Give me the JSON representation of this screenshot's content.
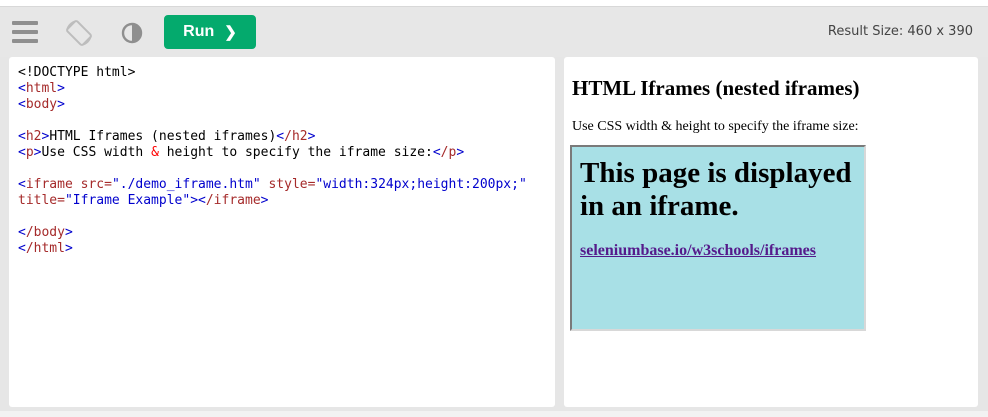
{
  "toolbar": {
    "run_label": "Run",
    "run_chevron": "❯",
    "result_size": "Result Size: 460 x 390",
    "icons": [
      "menu-icon",
      "rotate-icon",
      "contrast-icon"
    ],
    "colors": {
      "run_bg": "#04aa6d",
      "toolbar_bg": "#e7e7e7"
    }
  },
  "code": {
    "line1": "<!DOCTYPE html>",
    "html_open": "html",
    "body_open": "body",
    "h2_open": "h2",
    "h2_text": "HTML Iframes (nested iframes)",
    "h2_close": "/h2",
    "p_open": "p",
    "p_text1": "Use CSS width ",
    "p_entity": "&",
    "p_text2": " height to specify the iframe size:",
    "p_close": "/p",
    "iframe_tag": "iframe",
    "src_attr": " src=",
    "src_val": "\"./demo_iframe.htm\"",
    "style_attr": " style=",
    "style_val": "\"width:324px;height:200px;\"",
    "title_attr": "title=",
    "title_val": "\"Iframe Example\"",
    "iframe_close": "/iframe",
    "body_close": "/body",
    "html_close": "/html"
  },
  "result": {
    "heading": "HTML Iframes (nested iframes)",
    "paragraph": "Use CSS width & height to specify the iframe size:",
    "iframe": {
      "heading": "This page is displayed in an iframe.",
      "link": "seleniumbase.io/w3schools/iframes",
      "bg": "#a8e0e6"
    }
  }
}
